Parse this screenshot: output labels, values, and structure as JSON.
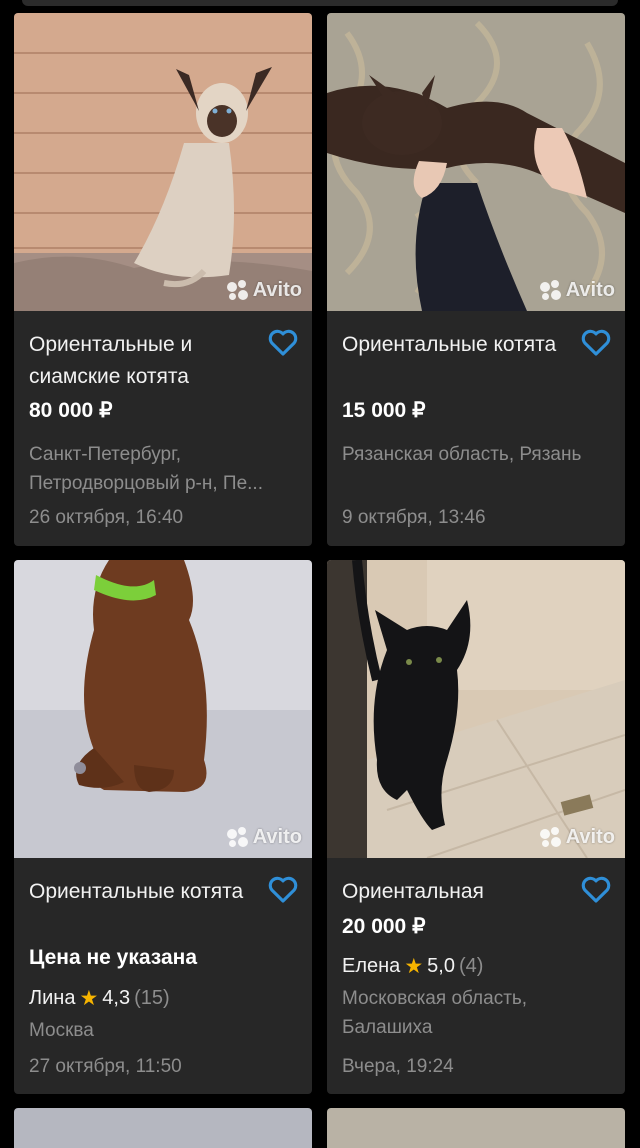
{
  "watermark": "Avito",
  "colors": {
    "accent": "#2f8fd8",
    "star": "#f6b400",
    "card_bg": "#272727",
    "muted": "#8d8d8d"
  },
  "listings": [
    {
      "title": "Ориентальные и сиамские котята",
      "price": "80 000 ₽",
      "location_line1": "Санкт-Петербург,",
      "location_line2": "Петродворцовый р-н, Пе...",
      "date": "26 октября, 16:40",
      "favorite_icon": "heart-outline-icon"
    },
    {
      "title": "Ориентальные котята",
      "price": "15 000 ₽",
      "location_line1": "Рязанская область, Рязань",
      "date": "9 октября, 13:46",
      "favorite_icon": "heart-outline-icon"
    },
    {
      "title": "Ориентальные котята",
      "price": "Цена не указана",
      "seller": {
        "name": "Лина",
        "rating": "4,3",
        "reviews": "(15)"
      },
      "location_line1": "Москва",
      "date": "27 октября, 11:50",
      "favorite_icon": "heart-outline-icon"
    },
    {
      "title": "Ориентальная",
      "price": "20 000 ₽",
      "seller": {
        "name": "Елена",
        "rating": "5,0",
        "reviews": "(4)"
      },
      "location_line1": "Московская область,",
      "location_line2": "Балашиха",
      "date": "Вчера, 19:24",
      "favorite_icon": "heart-outline-icon"
    }
  ]
}
